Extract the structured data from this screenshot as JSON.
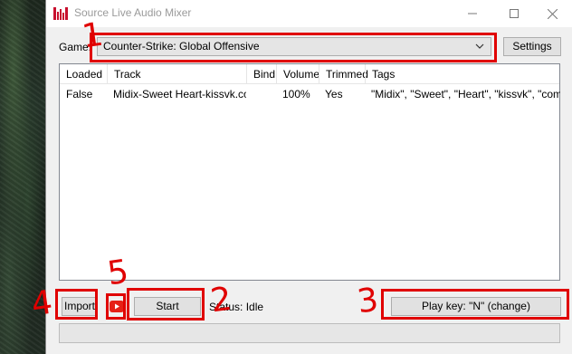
{
  "window": {
    "title": "Source Live Audio Mixer",
    "accent_color": "#c8102e"
  },
  "game": {
    "label": "Game:",
    "selected": "Counter-Strike: Global Offensive",
    "settings_label": "Settings"
  },
  "table": {
    "columns": [
      "Loaded",
      "Track",
      "Bind",
      "Volume",
      "Trimmed",
      "Tags"
    ],
    "rows": [
      {
        "loaded": "False",
        "track": "Midix-Sweet Heart-kissvk.com",
        "bind": "",
        "volume": "100%",
        "trimmed": "Yes",
        "tags": "\"Midix\", \"Sweet\", \"Heart\", \"kissvk\", \"com\""
      }
    ]
  },
  "controls": {
    "import_label": "Import",
    "start_label": "Start",
    "status_text": "Status: Idle",
    "play_key_label": "Play key: \"N\" (change)",
    "youtube_icon": "youtube-icon"
  },
  "annotations": {
    "color": "#e00000",
    "numbers": [
      "1",
      "2",
      "3",
      "4",
      "5"
    ]
  }
}
